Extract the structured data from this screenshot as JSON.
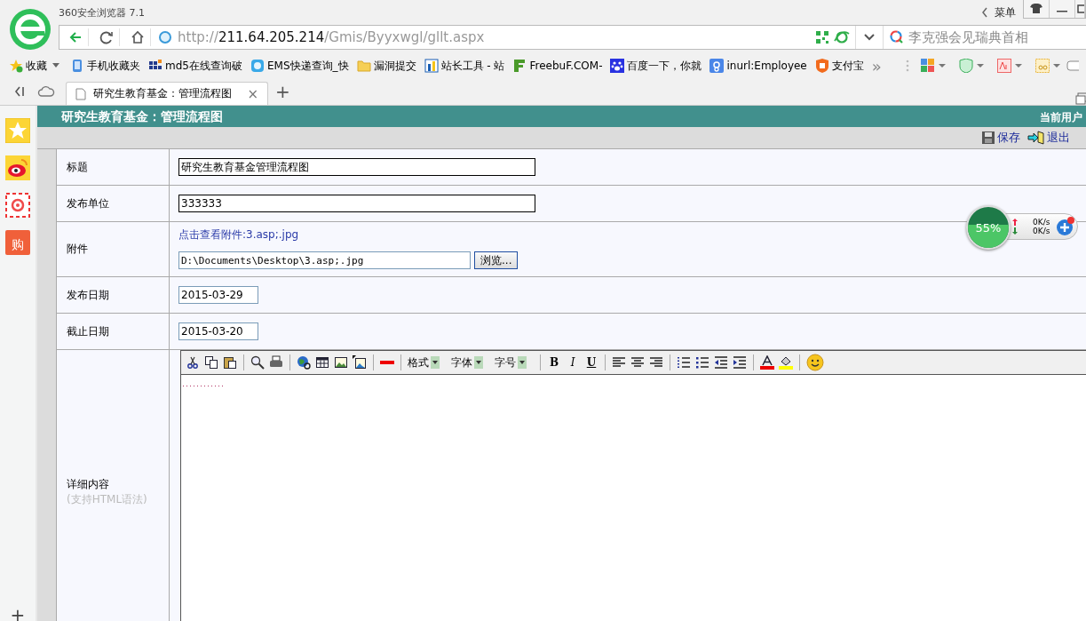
{
  "browser": {
    "title": "360安全浏览器 7.1",
    "menu_label": "菜单",
    "url": {
      "scheme": "http://",
      "host": "211.64.205.214",
      "path": "/Gmis/Byyxwgl/gllt.aspx"
    },
    "search": {
      "placeholder": "李克强会见瑞典首相"
    },
    "bookmarks": [
      {
        "label": "收藏",
        "kind": "star"
      },
      {
        "label": "手机收藏夹",
        "kind": "phone"
      },
      {
        "label": "md5在线查询破",
        "kind": "grid"
      },
      {
        "label": "EMS快递查询_快",
        "kind": "bubble"
      },
      {
        "label": "漏洞提交",
        "kind": "folder"
      },
      {
        "label": "站长工具 - 站",
        "kind": "bars"
      },
      {
        "label": "FreebuF.COM-",
        "kind": "f"
      },
      {
        "label": "百度一下，你就",
        "kind": "paw"
      },
      {
        "label": "inurl:Employee",
        "kind": "g"
      },
      {
        "label": "支付宝",
        "kind": "shield"
      }
    ],
    "more": "»",
    "tabs": [
      {
        "title": "研究生教育基金：管理流程图",
        "selected": true,
        "close": "×"
      }
    ],
    "new_tab": "+"
  },
  "sidebar": {
    "shop_glyph": "购",
    "add": "+"
  },
  "page": {
    "title": "研究生教育基金：管理流程图",
    "user": "当前用户",
    "actions": [
      {
        "label": "保存",
        "kind": "save"
      },
      {
        "label": "退出",
        "kind": "exit"
      }
    ],
    "rows": [
      {
        "label": "标题",
        "kind": "text",
        "value": "研究生教育基金管理流程图"
      },
      {
        "label": "发布单位",
        "kind": "text",
        "value": "333333"
      },
      {
        "label": "附件",
        "kind": "file",
        "link": "点击查看附件:3.asp;.jpg",
        "value": "D:\\Documents\\Desktop\\3.asp;.jpg",
        "button": "浏览..."
      },
      {
        "label": "发布日期",
        "kind": "date",
        "value": "2015-03-29"
      },
      {
        "label": "截止日期",
        "kind": "date",
        "value": "2015-03-20"
      },
      {
        "label": "详细内容",
        "hint": "(支持HTML语法)",
        "kind": "editor"
      }
    ],
    "toolbar": {
      "dropdowns": [
        "格式",
        "字体",
        "字号"
      ],
      "styles": [
        "B",
        "I",
        "U"
      ]
    }
  },
  "speed_widget": {
    "percent": "55%",
    "up": "0K/s",
    "down": "0K/s"
  }
}
